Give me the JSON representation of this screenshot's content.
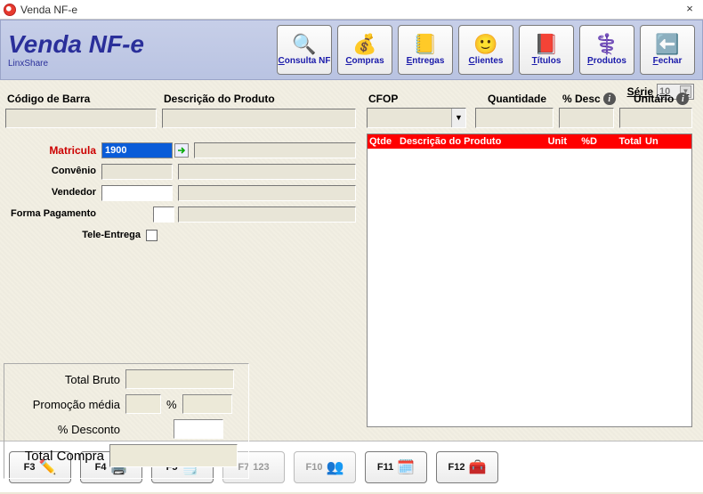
{
  "window": {
    "title": "Venda NF-e",
    "close": "×"
  },
  "header": {
    "title": "Venda NF-e",
    "subtitle": "LinxShare"
  },
  "toolbar": [
    {
      "name": "consulta-nf",
      "label": "Consulta NF",
      "underline": "C",
      "rest": "onsulta NF",
      "icon": "🔍"
    },
    {
      "name": "compras",
      "label": "Compras",
      "underline": "C",
      "rest": "ompras",
      "icon": "💰"
    },
    {
      "name": "entregas",
      "label": "Entregas",
      "underline": "E",
      "rest": "ntregas",
      "icon": "📒"
    },
    {
      "name": "clientes",
      "label": "Clientes",
      "underline": "C",
      "rest": "lientes",
      "icon": "🙂"
    },
    {
      "name": "titulos",
      "label": "Títulos",
      "underline": "T",
      "rest": "ítulos",
      "icon": "📕"
    },
    {
      "name": "produtos",
      "label": "Produtos",
      "underline": "P",
      "rest": "rodutos",
      "icon": "⚕️"
    },
    {
      "name": "fechar",
      "label": "Fechar",
      "underline": "F",
      "rest": "echar",
      "icon": "⬅️"
    }
  ],
  "serie": {
    "label": "Série",
    "value": "10"
  },
  "top_labels": {
    "barcode": "Código de Barra",
    "prod_desc": "Descrição do Produto",
    "cfop": "CFOP",
    "qty": "Quantidade",
    "pct_desc": "% Desc",
    "unit": "Unitário"
  },
  "left_fields": {
    "matricula_label": "Matricula",
    "matricula_value": "1900",
    "convenio_label": "Convênio",
    "vendedor_label": "Vendedor",
    "forma_pag_label": "Forma Pagamento",
    "tele_entrega_label": "Tele-Entrega"
  },
  "grid": {
    "columns": [
      "Qtde",
      "Descrição do Produto",
      "Unit",
      "%D",
      "Total",
      "Un"
    ]
  },
  "totals": {
    "total_bruto": "Total Bruto",
    "promo_media": "Promoção média",
    "pct": "%",
    "pct_desconto": "% Desconto",
    "total_compra": "Total Compra"
  },
  "fn": [
    {
      "key": "F3",
      "name": "f3",
      "icon": "✏️",
      "disabled": false
    },
    {
      "key": "F4",
      "name": "f4",
      "icon": "🖨️",
      "disabled": false
    },
    {
      "key": "F5",
      "name": "f5",
      "icon": "🗒️",
      "disabled": false
    },
    {
      "key": "F7",
      "name": "f7",
      "icon": "123",
      "disabled": true
    },
    {
      "key": "F10",
      "name": "f10",
      "icon": "👥",
      "disabled": true
    },
    {
      "key": "F11",
      "name": "f11",
      "icon": "🗓️",
      "disabled": false
    },
    {
      "key": "F12",
      "name": "f12",
      "icon": "🧰",
      "disabled": false
    }
  ]
}
